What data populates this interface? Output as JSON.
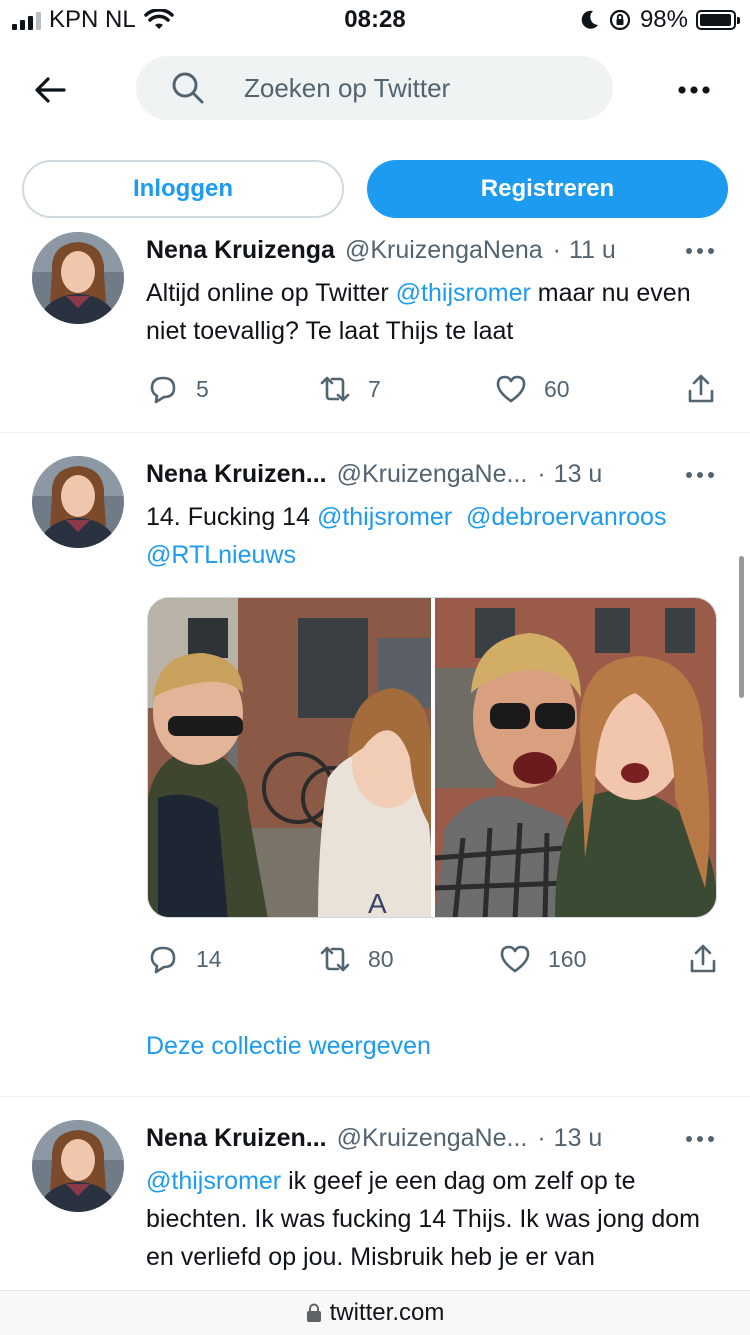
{
  "status_bar": {
    "carrier": "KPN NL",
    "time": "08:28",
    "battery": "98%",
    "battery_level": 0.98
  },
  "search": {
    "placeholder": "Zoeken op Twitter"
  },
  "auth": {
    "login_label": "Inloggen",
    "register_label": "Registreren"
  },
  "tweets": [
    {
      "name": "Nena Kruizenga",
      "handle": "@KruizengaNena",
      "time": "11 u",
      "text_1": "Altijd online op Twitter ",
      "mention_1": "@thijsromer",
      "text_2": "  maar nu even niet toevallig? Te laat Thijs te laat",
      "replies": "5",
      "retweets": "7",
      "likes": "60"
    },
    {
      "name": "Nena Kruizen...",
      "handle": "@KruizengaNe...",
      "time": "13 u",
      "text_1": "14. Fucking 14 ",
      "mention_1": "@thijsromer",
      "mention_2": "@debroervanroos",
      "mention_3": "@RTLnieuws",
      "replies": "14",
      "retweets": "80",
      "likes": "160",
      "collection_link": "Deze collectie weergeven"
    },
    {
      "name": "Nena Kruizen...",
      "handle": "@KruizengaNe...",
      "time": "13 u",
      "mention_1": "@thijsromer",
      "text_1": " ik geef je een dag om zelf op te biechten. Ik was fucking 14 Thijs. Ik was jong dom en verliefd op jou. Misbruik heb je er van"
    }
  ],
  "url_bar": {
    "domain": "twitter.com"
  },
  "colors": {
    "accent": "#1d9bf0",
    "text": "#0f1419",
    "muted": "#536471"
  },
  "icons": [
    "back-arrow-icon",
    "search-icon",
    "more-icon",
    "reply-icon",
    "retweet-icon",
    "like-icon",
    "share-icon",
    "lock-icon"
  ]
}
